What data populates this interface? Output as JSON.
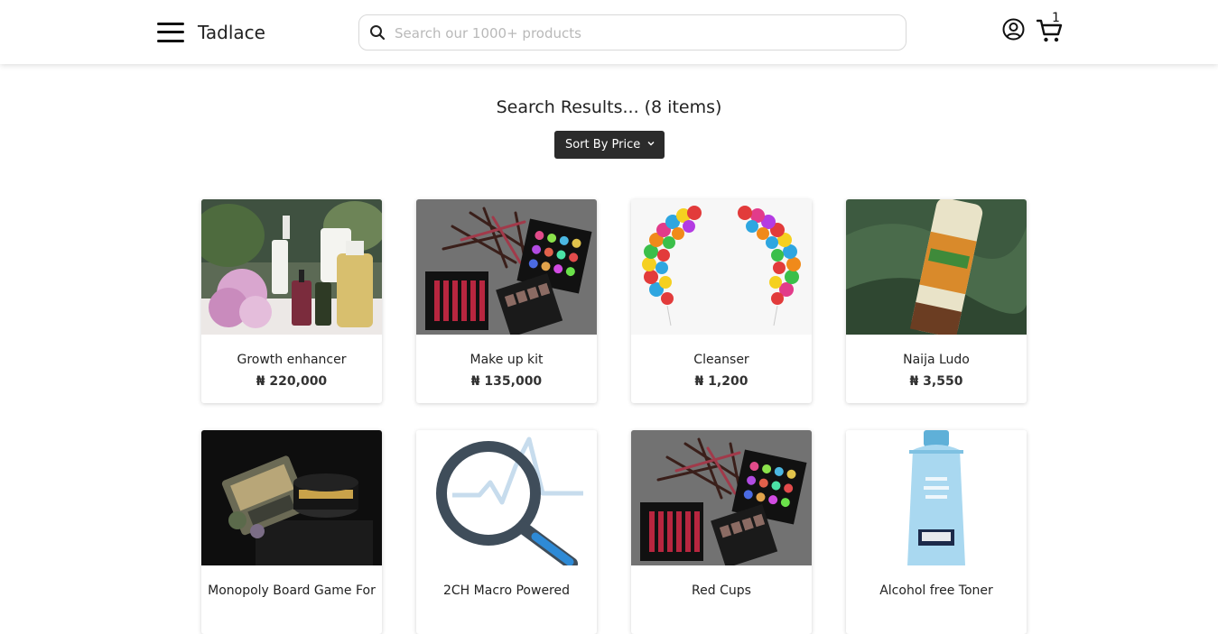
{
  "header": {
    "brand": "Tadlace",
    "search_placeholder": "Search our 1000+ products",
    "cart_count": "1"
  },
  "results": {
    "title": "Search Results... (8 items)",
    "sort_label": "Sort By Price"
  },
  "products": [
    {
      "name": "Growth enhancer",
      "price": "₦ 220,000",
      "image": "skincare-bottles-with-peonies"
    },
    {
      "name": "Make up kit",
      "price": "₦ 135,000",
      "image": "makeup-palettes-and-pencils"
    },
    {
      "name": "Cleanser",
      "price": "₦ 1,200",
      "image": "balloon-arches"
    },
    {
      "name": "Naija Ludo",
      "price": "₦ 3,550",
      "image": "scrub-tube-on-green-fabric"
    },
    {
      "name": "Monopoly Board Game For",
      "price": "",
      "image": "dark-luxury-jars"
    },
    {
      "name": "2CH Macro Powered",
      "price": "",
      "image": "magnifier-chart-placeholder"
    },
    {
      "name": "Red Cups",
      "price": "",
      "image": "makeup-palettes-and-pencils"
    },
    {
      "name": "Alcohol free Toner",
      "price": "",
      "image": "blue-toner-bottle"
    }
  ],
  "icons": {
    "menu": "hamburger-icon",
    "search": "search-icon",
    "account": "user-circle-icon",
    "cart": "cart-icon",
    "sort": "chevron-down-icon"
  },
  "colors": {
    "sort_button_bg": "#2b2b2b",
    "page_bg": "#ffffff"
  }
}
